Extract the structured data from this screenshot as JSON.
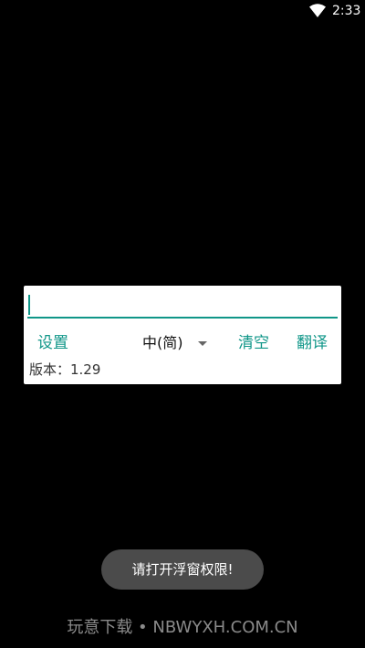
{
  "status_bar": {
    "time": "2:33",
    "wifi_icon": "wifi-icon"
  },
  "card": {
    "input": {
      "value": ""
    },
    "settings_label": "设置",
    "language": {
      "selected": "中(简)",
      "icon": "chevron-down-icon"
    },
    "clear_label": "清空",
    "translate_label": "翻译",
    "version_text": "版本：1.29"
  },
  "toast": {
    "message": "请打开浮窗权限!"
  },
  "watermark": {
    "text": "玩意下载 • NBWYXH.COM.CN"
  },
  "colors": {
    "accent": "#0f9688",
    "background": "#000000",
    "card": "#ffffff",
    "toast": "#4b4b4b"
  }
}
